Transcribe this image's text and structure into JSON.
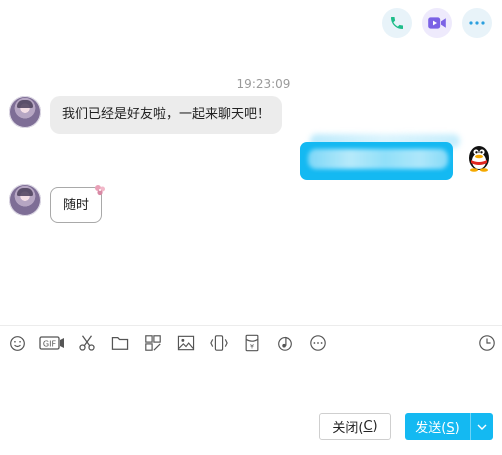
{
  "header_actions": [
    {
      "icon": "phone-icon"
    },
    {
      "icon": "video-call-icon"
    },
    {
      "icon": "more-icon"
    }
  ],
  "chat": {
    "timestamp": "19:23:09",
    "messages": [
      {
        "side": "left",
        "text": "我们已经是好友啦，一起来聊天吧！"
      },
      {
        "side": "right",
        "text": ""
      },
      {
        "side": "left",
        "text": "随时"
      }
    ]
  },
  "toolbar": {
    "tools": [
      "emoji-icon",
      "gif-icon",
      "scissors-icon",
      "folder-icon",
      "file-grid-icon",
      "image-icon",
      "shake-icon",
      "red-packet-icon",
      "music-icon",
      "more-options-icon"
    ],
    "right_tool": "history-clock-icon"
  },
  "buttons": {
    "close_label": "关闭(",
    "close_key": "C",
    "close_tail": ")",
    "send_label": "发送(",
    "send_key": "S",
    "send_tail": ")"
  },
  "colors": {
    "accent": "#14b9f2",
    "phone_green": "#1fbd8a",
    "video_purple": "#7b62e5",
    "more_blue": "#2a9fde"
  }
}
